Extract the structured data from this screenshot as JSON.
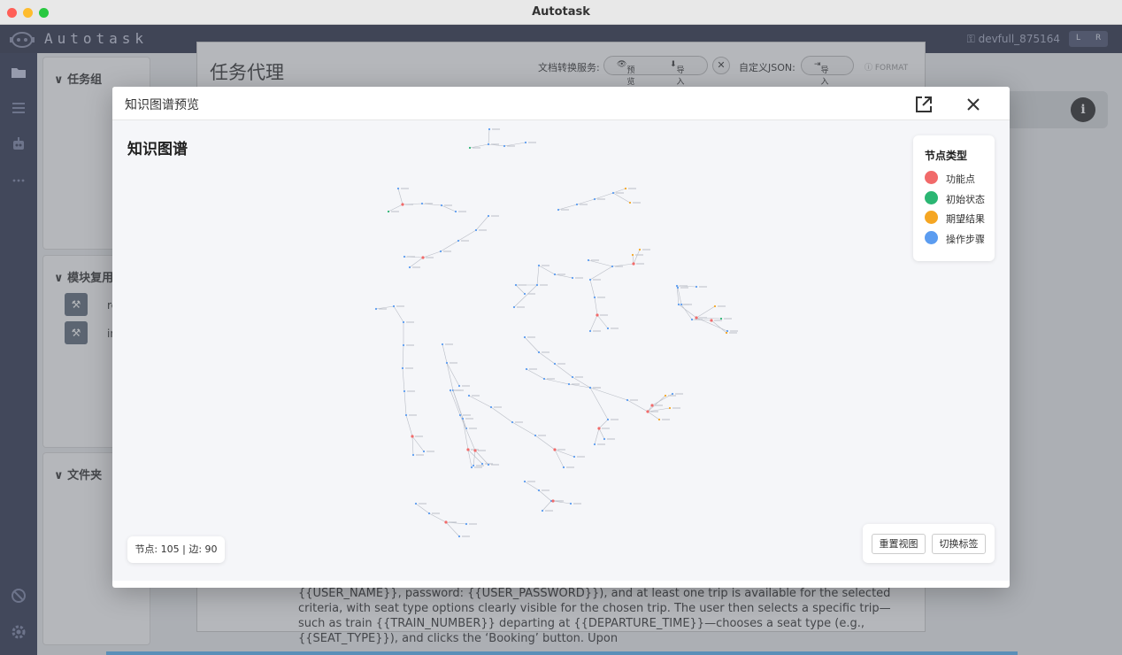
{
  "window": {
    "title": "Autotask"
  },
  "app": {
    "logo_text": "Autotask",
    "user": "devfull_875164",
    "lang_left": "L",
    "lang_right": "R"
  },
  "sidebar": {
    "task_group": "任务组",
    "module_reuse": "模块复用",
    "modules": [
      {
        "label": "re"
      },
      {
        "label": "in"
      }
    ],
    "folder": "文件夹"
  },
  "main": {
    "title": "任务代理",
    "doc_service_label": "文档转换服务:",
    "preview_label": "预览",
    "import_label": "导入",
    "custom_json_label": "自定义JSON:",
    "json_import_label": "导入",
    "format_label": "FORMAT",
    "body_text": "{{USER_NAME}}, password: {{USER_PASSWORD}}), and at least one trip is available for the selected criteria, with seat type options clearly visible for the chosen trip. The user then selects a specific trip—such as train {{TRAIN_NUMBER}} departing at {{DEPARTURE_TIME}}—chooses a seat type (e.g., {{SEAT_TYPE}}), and clicks the ‘Booking’ button. Upon"
  },
  "modal": {
    "title": "知识图谱预览",
    "graph_title": "知识图谱",
    "legend_title": "节点类型",
    "legend": [
      {
        "label": "功能点",
        "color": "#f16a6a"
      },
      {
        "label": "初始状态",
        "color": "#2bb673"
      },
      {
        "label": "期望结果",
        "color": "#f5a623"
      },
      {
        "label": "操作步骤",
        "color": "#5b9cf0"
      }
    ],
    "stats": "节点: 105 | 边: 90",
    "reset_view": "重置视图",
    "toggle_labels": "切换标签"
  },
  "graph": {
    "node_count": 105,
    "edge_count": 90,
    "colors": {
      "feature": "#f16a6a",
      "initial": "#2bb673",
      "expected": "#f5a623",
      "step": "#5b9cf0"
    }
  }
}
